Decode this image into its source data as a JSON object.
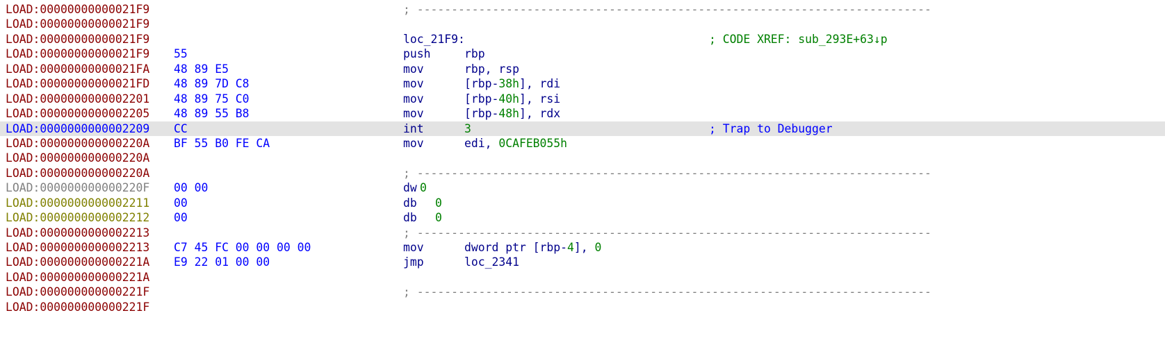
{
  "segment": "LOAD",
  "colors": {
    "address": "#8b0000",
    "address_highlighted": "#0000ff",
    "address_unexplored": "#808080",
    "address_data": "#808000",
    "bytes": "#0000ff",
    "instruction": "#00008b",
    "number": "#008000",
    "comment": "#0000ff",
    "xref": "#008000",
    "highlight_row_bg": "#e3e3e3"
  },
  "separator": "; ---------------------------------------------------------------------------",
  "rows": [
    {
      "addr": "LOAD:00000000000021F9",
      "type": "separator"
    },
    {
      "addr": "LOAD:00000000000021F9",
      "type": "blank"
    },
    {
      "addr": "LOAD:00000000000021F9",
      "type": "label",
      "label": "loc_21F9:",
      "comment": "; CODE XREF: sub_293E+63↓p"
    },
    {
      "addr": "LOAD:00000000000021F9",
      "bytes": "55",
      "type": "insn",
      "mnem": "push",
      "ops": [
        {
          "t": "rbp",
          "c": "reg"
        }
      ]
    },
    {
      "addr": "LOAD:00000000000021FA",
      "bytes": "48 89 E5",
      "type": "insn",
      "mnem": "mov",
      "ops": [
        {
          "t": "rbp, rsp",
          "c": "reg"
        }
      ]
    },
    {
      "addr": "LOAD:00000000000021FD",
      "bytes": "48 89 7D C8",
      "type": "insn",
      "mnem": "mov",
      "ops": [
        {
          "t": "[rbp-",
          "c": "reg"
        },
        {
          "t": "38h",
          "c": "num"
        },
        {
          "t": "], rdi",
          "c": "reg"
        }
      ]
    },
    {
      "addr": "LOAD:0000000000002201",
      "bytes": "48 89 75 C0",
      "type": "insn",
      "mnem": "mov",
      "ops": [
        {
          "t": "[rbp-",
          "c": "reg"
        },
        {
          "t": "40h",
          "c": "num"
        },
        {
          "t": "], rsi",
          "c": "reg"
        }
      ]
    },
    {
      "addr": "LOAD:0000000000002205",
      "bytes": "48 89 55 B8",
      "type": "insn",
      "mnem": "mov",
      "ops": [
        {
          "t": "[rbp-",
          "c": "reg"
        },
        {
          "t": "48h",
          "c": "num"
        },
        {
          "t": "], rdx",
          "c": "reg"
        }
      ]
    },
    {
      "addr": "LOAD:0000000000002209",
      "bytes": "CC",
      "type": "insn",
      "mnem": "int",
      "ops": [
        {
          "t": "3",
          "c": "num"
        }
      ],
      "comment": "; Trap to Debugger",
      "highlight": true
    },
    {
      "addr": "LOAD:000000000000220A",
      "bytes": "BF 55 B0 FE CA",
      "type": "insn",
      "mnem": "mov",
      "ops": [
        {
          "t": "edi, ",
          "c": "reg"
        },
        {
          "t": "0CAFEB055h",
          "c": "num"
        }
      ]
    },
    {
      "addr": "LOAD:000000000000220A",
      "type": "blank"
    },
    {
      "addr": "LOAD:000000000000220A",
      "type": "separator"
    },
    {
      "addr": "LOAD:000000000000220F",
      "bytes": "00 00",
      "type": "data",
      "addr_style": "gray",
      "dir": "dw",
      "val": "0",
      "tight": true
    },
    {
      "addr": "LOAD:0000000000002211",
      "bytes": "00",
      "type": "data",
      "addr_style": "olive",
      "dir": "db",
      "val": "0"
    },
    {
      "addr": "LOAD:0000000000002212",
      "bytes": "00",
      "type": "data",
      "addr_style": "olive",
      "dir": "db",
      "val": "0"
    },
    {
      "addr": "LOAD:0000000000002213",
      "type": "separator"
    },
    {
      "addr": "LOAD:0000000000002213",
      "bytes": "C7 45 FC 00 00 00 00",
      "type": "insn",
      "mnem": "mov",
      "ops": [
        {
          "t": "dword ptr [rbp-",
          "c": "reg"
        },
        {
          "t": "4",
          "c": "num"
        },
        {
          "t": "], ",
          "c": "reg"
        },
        {
          "t": "0",
          "c": "num"
        }
      ]
    },
    {
      "addr": "LOAD:000000000000221A",
      "bytes": "E9 22 01 00 00",
      "type": "insn",
      "mnem": "jmp",
      "ops": [
        {
          "t": "loc_2341",
          "c": "reg"
        }
      ]
    },
    {
      "addr": "LOAD:000000000000221A",
      "type": "blank"
    },
    {
      "addr": "LOAD:000000000000221F",
      "type": "separator"
    },
    {
      "addr": "LOAD:000000000000221F",
      "type": "blank"
    }
  ]
}
